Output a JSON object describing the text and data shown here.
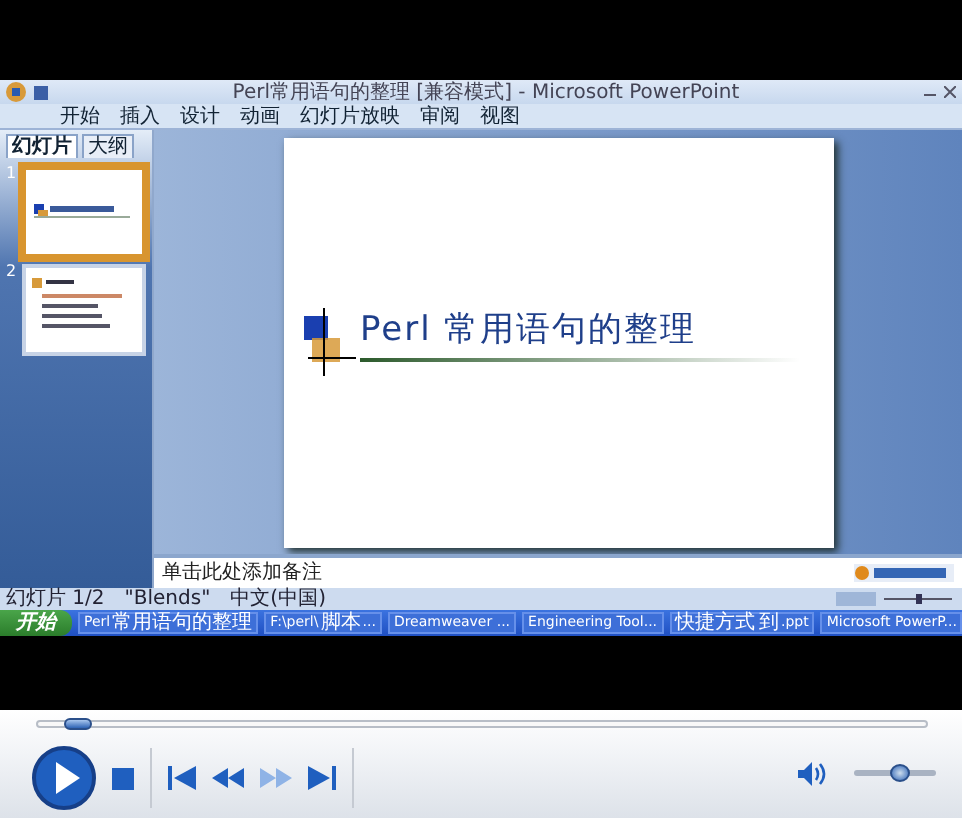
{
  "recording": {
    "window": {
      "title": "Perl常用语句的整理 [兼容模式] - Microsoft PowerPoint"
    },
    "ribbon_tabs": [
      "开始",
      "插入",
      "设计",
      "动画",
      "幻灯片放映",
      "审阅",
      "视图"
    ],
    "pane_tabs": [
      {
        "label": "幻灯片",
        "selected": true
      },
      {
        "label": "大纲",
        "selected": false
      }
    ],
    "slides": [
      {
        "number": "1",
        "selected": true,
        "kind": "title"
      },
      {
        "number": "2",
        "selected": false,
        "kind": "list"
      }
    ],
    "slide": {
      "title": "Perl 常用语句的整理"
    },
    "notes": {
      "text": "单击此处添加备注"
    },
    "status_bar": [
      "幻灯片 1/2",
      "\"Blends\"",
      "中文(中国)"
    ],
    "taskbar": {
      "start": "开始",
      "items": [
        {
          "label": "Perl常用语句的整理"
        },
        {
          "label": "F:\\perl\\脚本..."
        },
        {
          "label": "Dreamweaver ..."
        },
        {
          "label": "Engineering Tool..."
        },
        {
          "label": "快捷方式 到.ppt"
        },
        {
          "label": "Microsoft PowerP..."
        }
      ]
    }
  },
  "controls": {
    "seek": {
      "level": 0.03
    },
    "buttons": [
      {
        "kind": "play",
        "disabled": false
      },
      {
        "kind": "stop",
        "disabled": false
      },
      {
        "kind": "previous",
        "disabled": false
      },
      {
        "kind": "rewind",
        "disabled": false
      },
      {
        "kind": "fast-forward",
        "disabled": true
      },
      {
        "kind": "next",
        "disabled": false
      }
    ],
    "volume": {
      "level": 0.55
    }
  }
}
